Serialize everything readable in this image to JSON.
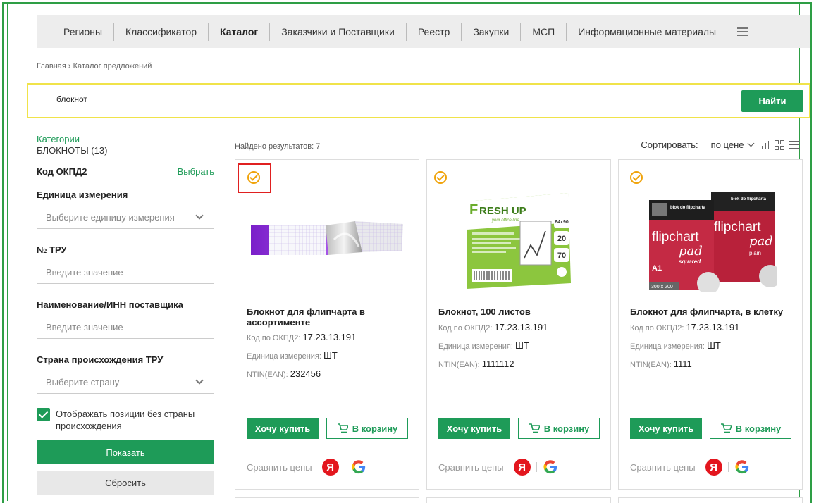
{
  "nav": {
    "items": [
      "Регионы",
      "Классификатор",
      "Каталог",
      "Заказчики и Поставщики",
      "Реестр",
      "Закупки",
      "МСП",
      "Информационные материалы"
    ],
    "active": "Каталог"
  },
  "breadcrumb": "Главная › Каталог предложений",
  "search": {
    "value": "блокнот",
    "button": "Найти"
  },
  "sidebar": {
    "categories_label": "Категории",
    "categories_value": "БЛОКНОТЫ (13)",
    "okpd_label": "Код ОКПД2",
    "okpd_action": "Выбрать",
    "unit_label": "Единица измерения",
    "unit_placeholder": "Выберите единицу измерения",
    "tru_label": "№ ТРУ",
    "tru_placeholder": "Введите значение",
    "supplier_label": "Наименование/ИНН поставщика",
    "supplier_placeholder": "Введите значение",
    "country_label": "Страна происхождения ТРУ",
    "country_placeholder": "Выберите страну",
    "checkbox_label": "Отображать позиции без страны происхождения",
    "show_button": "Показать",
    "reset_button": "Сбросить"
  },
  "results": {
    "found": "Найдено результатов: 7",
    "sort_label": "Сортировать:",
    "sort_value": "по цене"
  },
  "products": [
    {
      "title": "Блокнот для флипчарта в ассортименте",
      "okpd_label": "Код по ОКПД2:",
      "okpd": "17.23.13.191",
      "unit_label": "Единица измерения:",
      "unit": "ШТ",
      "ntin_label": "NTIN(EAN):",
      "ntin": "232456"
    },
    {
      "title": "Блокнот, 100 листов",
      "okpd_label": "Код по ОКПД2:",
      "okpd": "17.23.13.191",
      "unit_label": "Единица измерения:",
      "unit": "ШТ",
      "ntin_label": "NTIN(EAN):",
      "ntin": "1111112"
    },
    {
      "title": "Блокнот для флипчарта, в клетку",
      "okpd_label": "Код по ОКПД2:",
      "okpd": "17.23.13.191",
      "unit_label": "Единица измерения:",
      "unit": "ШТ",
      "ntin_label": "NTIN(EAN):",
      "ntin": "1111"
    }
  ],
  "card_actions": {
    "buy": "Хочу купить",
    "cart": "В корзину",
    "compare": "Сравнить цены",
    "yandex": "Я",
    "google": "G"
  },
  "images": {
    "freshup_brand": "RESH UP",
    "freshup_sub": "your office line",
    "freshup_size": "64x90",
    "freshup_sheets": "20",
    "freshup_density": "70",
    "flip_brand": "blok do flipcharta",
    "flip_word1": "flipchart",
    "flip_word2": "pad",
    "flip_var1": "squared",
    "flip_var2": "plain",
    "flip_size": "A1",
    "flip_dims": "300 x 200"
  },
  "colors": {
    "primary": "#1e9b58",
    "frame": "#2e9e45",
    "search_border": "#f0e34a",
    "badge": "#f0a30a",
    "highlight": "#e02020"
  }
}
